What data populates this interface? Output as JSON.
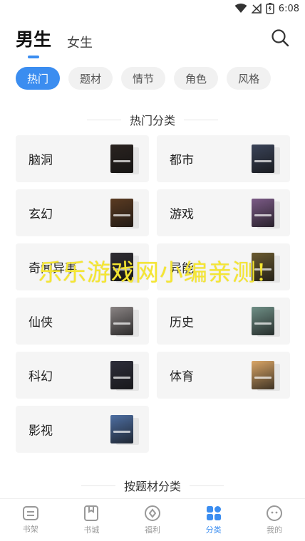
{
  "status_bar": {
    "time": "6:08"
  },
  "top_tabs": [
    {
      "label": "男生",
      "active": true
    },
    {
      "label": "女生",
      "active": false
    }
  ],
  "filters": [
    {
      "label": "热门",
      "active": true
    },
    {
      "label": "题材",
      "active": false
    },
    {
      "label": "情节",
      "active": false
    },
    {
      "label": "角色",
      "active": false
    },
    {
      "label": "风格",
      "active": false
    }
  ],
  "sections": {
    "hot": "热门分类",
    "by_theme": "按题材分类"
  },
  "categories": [
    {
      "label": "脑洞",
      "cover_color": "#2a2320"
    },
    {
      "label": "都市",
      "cover_color": "#3a4358"
    },
    {
      "label": "玄幻",
      "cover_color": "#5b3b22"
    },
    {
      "label": "游戏",
      "cover_color": "#7b5a86"
    },
    {
      "label": "奇闻异事",
      "cover_color": "#2f2d33"
    },
    {
      "label": "异能",
      "cover_color": "#6a5a30"
    },
    {
      "label": "仙侠",
      "cover_color": "#8a8484"
    },
    {
      "label": "历史",
      "cover_color": "#6f8f86"
    },
    {
      "label": "科幻",
      "cover_color": "#2e2e3a"
    },
    {
      "label": "体育",
      "cover_color": "#d9a566"
    },
    {
      "label": "影视",
      "cover_color": "#4e6fa3"
    }
  ],
  "watermark": "乐乐游戏网小编亲测!",
  "bottom_nav": [
    {
      "label": "书架",
      "icon": "bookshelf-icon",
      "active": false
    },
    {
      "label": "书城",
      "icon": "bookstore-icon",
      "active": false
    },
    {
      "label": "福利",
      "icon": "welfare-icon",
      "active": false
    },
    {
      "label": "分类",
      "icon": "category-icon",
      "active": true
    },
    {
      "label": "我的",
      "icon": "profile-icon",
      "active": false
    }
  ],
  "colors": {
    "accent": "#3b8df0",
    "card_bg": "#f5f5f5",
    "watermark": "#f5e632"
  }
}
